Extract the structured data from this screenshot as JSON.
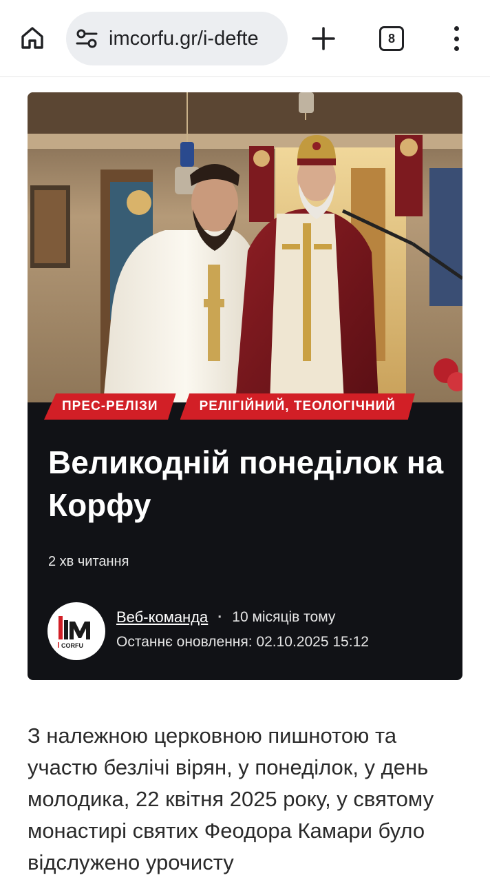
{
  "browser": {
    "url_display": "imcorfu.gr/i-defte",
    "tab_count": "8",
    "icons": [
      "home-icon",
      "site-settings-icon",
      "plus-icon",
      "tabs-icon",
      "menu-icon"
    ]
  },
  "article": {
    "tags": [
      "ПРЕС-РЕЛІЗИ",
      "РЕЛІГІЙНИЙ, ТЕОЛОГІЧНИЙ"
    ],
    "title": "Великодній понеділок на Корфу",
    "read_time": "2 хв читання",
    "author": {
      "name": "Веб-команда",
      "posted": "10 місяців тому",
      "updated": "Останнє оновлення: 02.10.2025 15:12",
      "logo_text": "IM",
      "logo_sub": "CORFU"
    },
    "body": "З належною церковною пишнотою та участю безлічі вірян, у понеділок, у день молодика, 22 квітня 2025 року, у святому монастирі святих Феодора Камари було відслужено урочисту"
  },
  "colors": {
    "accent": "#d21f26",
    "card_bg": "#111216",
    "urlbar_bg": "#eceef1"
  }
}
